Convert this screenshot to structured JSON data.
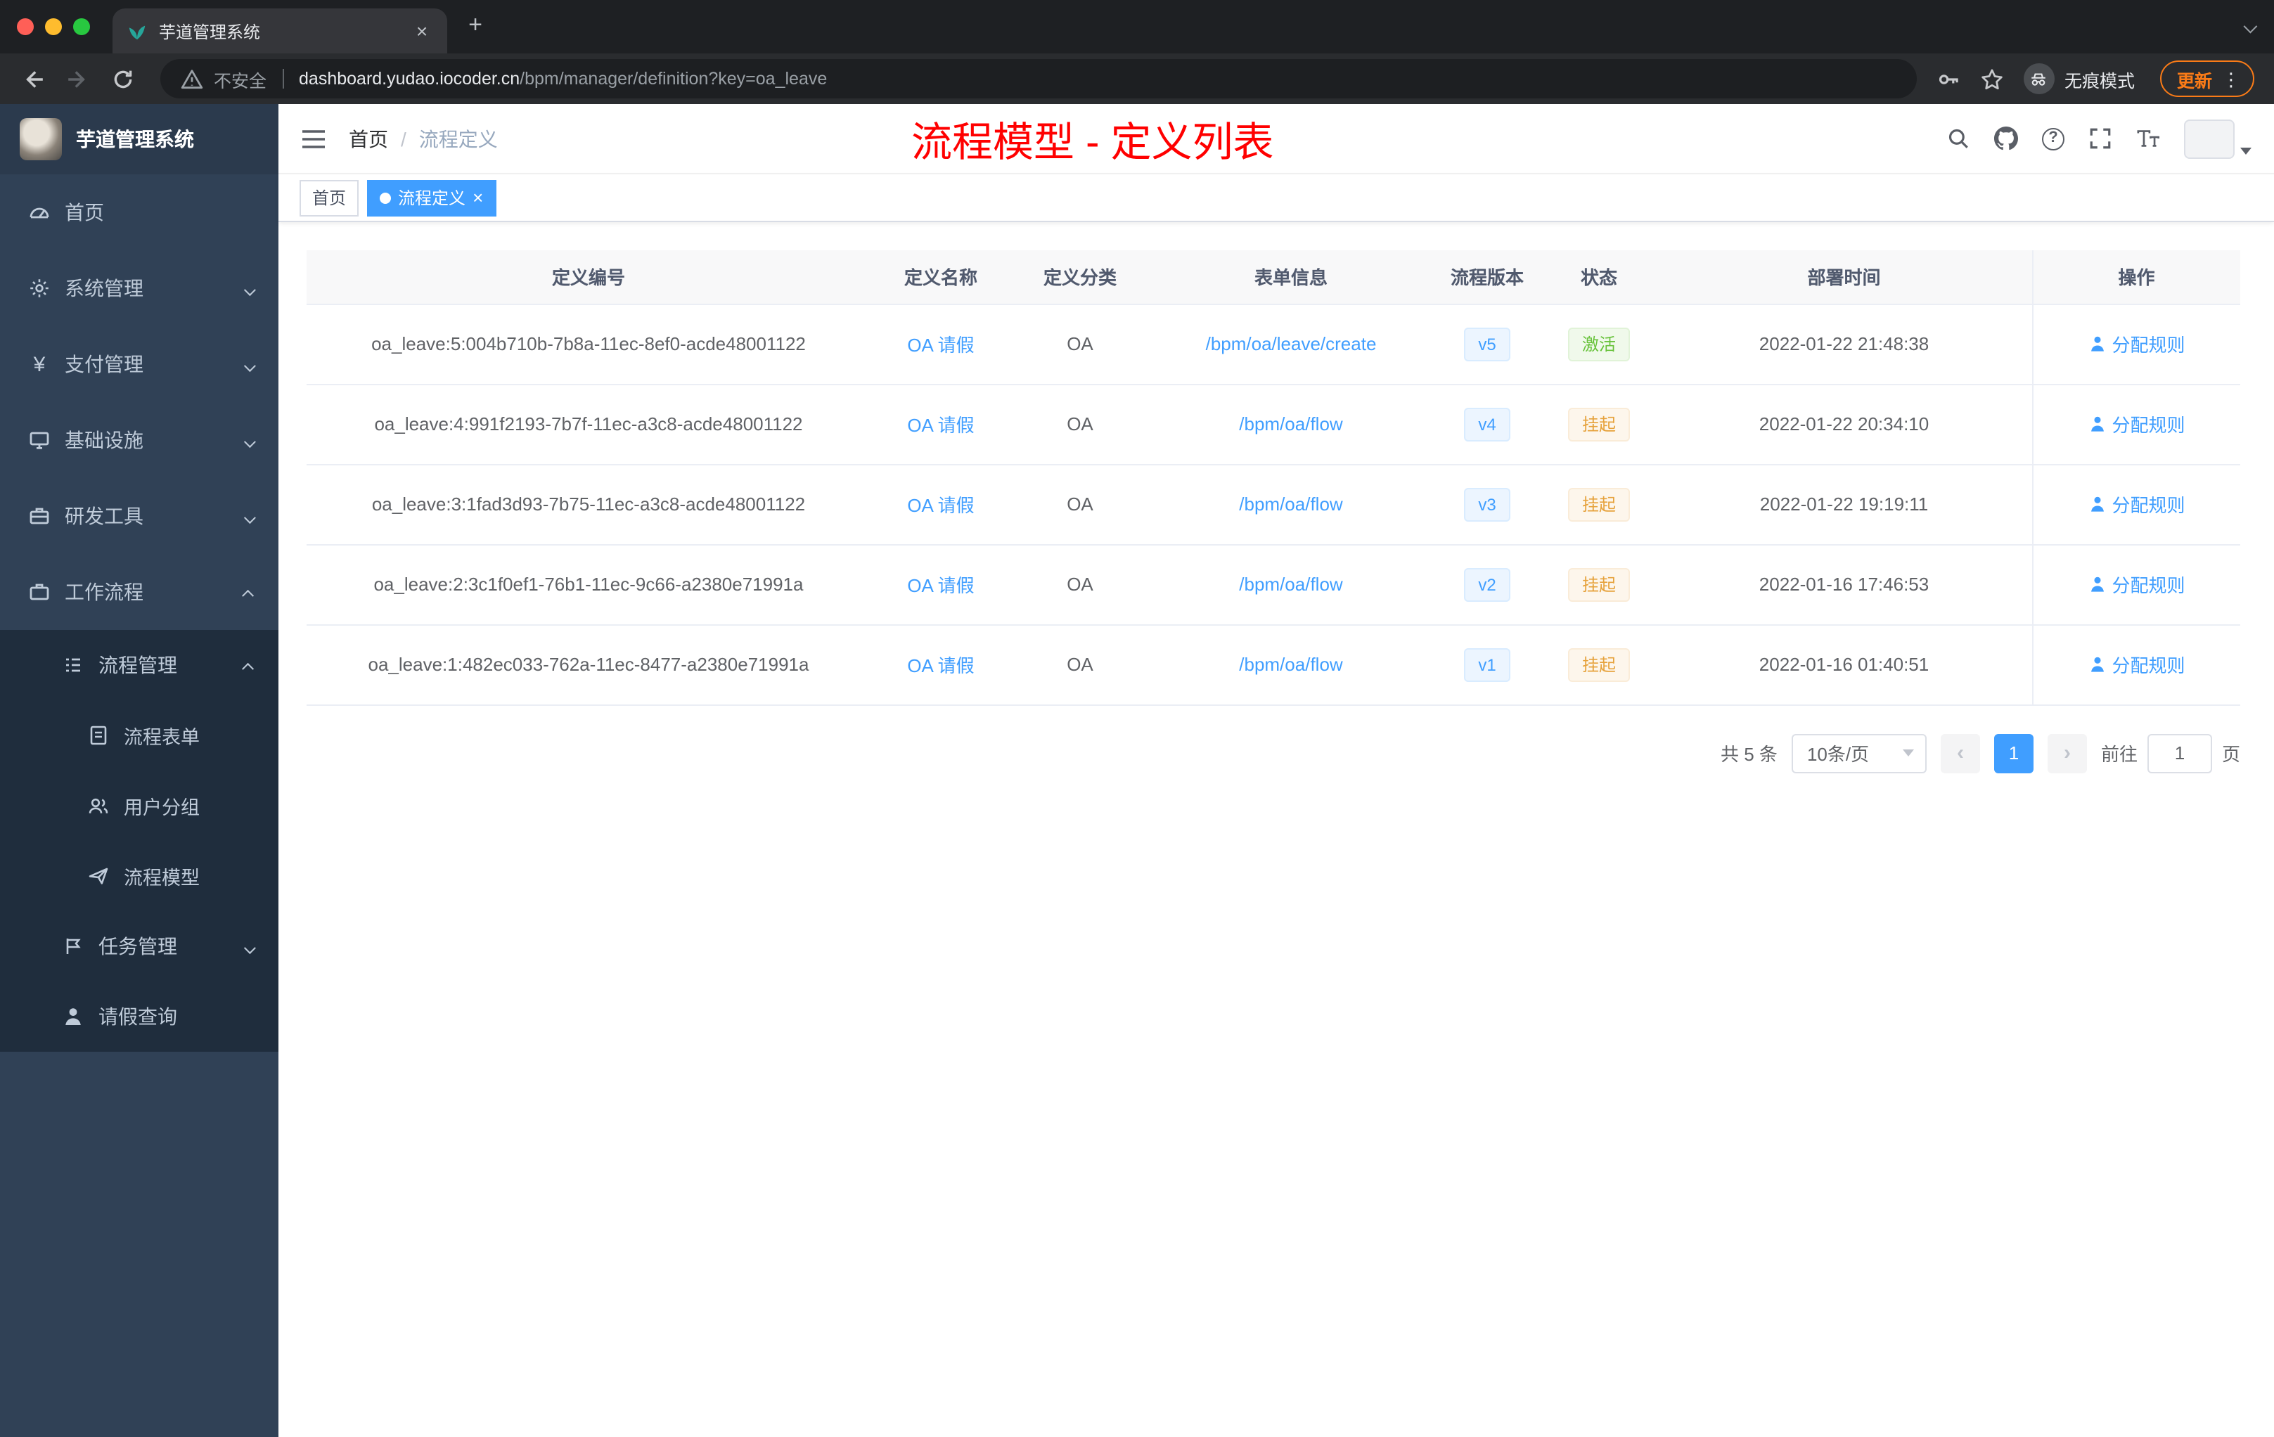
{
  "colors": {
    "accent": "#409eff",
    "success": "#67c23a",
    "warning": "#e6a23c",
    "annotation_red": "#ff0000",
    "sidebar_bg": "#304156",
    "submenu_bg": "#1f2d3d"
  },
  "browser": {
    "tab_title": "芋道管理系统",
    "security_label": "不安全",
    "url_host": "dashboard.yudao.iocoder.cn",
    "url_path": "/bpm/manager/definition?key=oa_leave",
    "incognito_label": "无痕模式",
    "update_label": "更新"
  },
  "sidebar": {
    "logo_title": "芋道管理系统",
    "items": [
      "首页",
      "系统管理",
      "支付管理",
      "基础设施",
      "研发工具",
      "工作流程"
    ],
    "submenu": [
      "流程管理",
      "流程表单",
      "用户分组",
      "流程模型",
      "任务管理",
      "请假查询"
    ]
  },
  "header": {
    "breadcrumb": [
      "首页",
      "流程定义"
    ],
    "annotation": "流程模型 - 定义列表"
  },
  "tags": [
    {
      "label": "首页",
      "active": false
    },
    {
      "label": "流程定义",
      "active": true
    }
  ],
  "table": {
    "columns": [
      "定义编号",
      "定义名称",
      "定义分类",
      "表单信息",
      "流程版本",
      "状态",
      "部署时间",
      "操作"
    ],
    "rows": [
      {
        "id": "oa_leave:5:004b710b-7b8a-11ec-8ef0-acde48001122",
        "name": "OA 请假",
        "category": "OA",
        "form": "/bpm/oa/leave/create",
        "version": "v5",
        "status": "激活",
        "time": "2022-01-22 21:48:38",
        "action": "分配规则"
      },
      {
        "id": "oa_leave:4:991f2193-7b7f-11ec-a3c8-acde48001122",
        "name": "OA 请假",
        "category": "OA",
        "form": "/bpm/oa/flow",
        "version": "v4",
        "status": "挂起",
        "time": "2022-01-22 20:34:10",
        "action": "分配规则"
      },
      {
        "id": "oa_leave:3:1fad3d93-7b75-11ec-a3c8-acde48001122",
        "name": "OA 请假",
        "category": "OA",
        "form": "/bpm/oa/flow",
        "version": "v3",
        "status": "挂起",
        "time": "2022-01-22 19:19:11",
        "action": "分配规则"
      },
      {
        "id": "oa_leave:2:3c1f0ef1-76b1-11ec-9c66-a2380e71991a",
        "name": "OA 请假",
        "category": "OA",
        "form": "/bpm/oa/flow",
        "version": "v2",
        "status": "挂起",
        "time": "2022-01-16 17:46:53",
        "action": "分配规则"
      },
      {
        "id": "oa_leave:1:482ec033-762a-11ec-8477-a2380e71991a",
        "name": "OA 请假",
        "category": "OA",
        "form": "/bpm/oa/flow",
        "version": "v1",
        "status": "挂起",
        "time": "2022-01-16 01:40:51",
        "action": "分配规则"
      }
    ]
  },
  "pagination": {
    "total": "共 5 条",
    "page_size": "10条/页",
    "current_page": "1",
    "goto_label": "前往",
    "goto_value": "1",
    "page_unit": "页"
  }
}
